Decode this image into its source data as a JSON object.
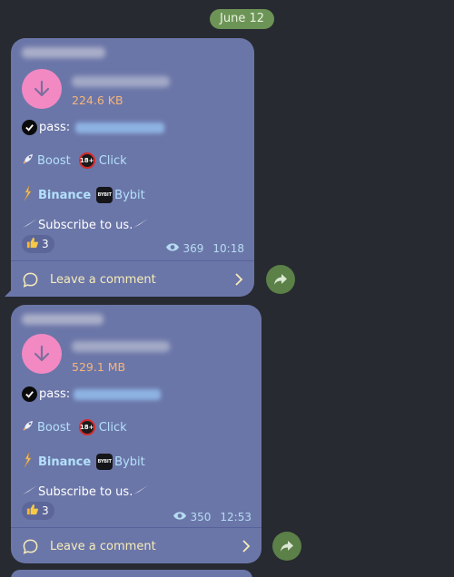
{
  "date_label": "June 12",
  "messages": [
    {
      "file_size": "224.6 KB",
      "pass_label": "pass:",
      "boost_label": "Boost",
      "badge_18": "18+",
      "click_label": "Click",
      "binance_label": "Binance",
      "bybit_icon_text": "BYBIT",
      "bybit_label": "Bybit",
      "subscribe_label": "Subscribe to us.",
      "reaction_count": "3",
      "views": "369",
      "time": "10:18",
      "comment_label": "Leave a comment"
    },
    {
      "file_size": "529.1 MB",
      "pass_label": "pass:",
      "boost_label": "Boost",
      "badge_18": "18+",
      "click_label": "Click",
      "binance_label": "Binance",
      "bybit_icon_text": "BYBIT",
      "bybit_label": "Bybit",
      "subscribe_label": "Subscribe to us.",
      "reaction_count": "3",
      "views": "350",
      "time": "12:53",
      "comment_label": "Leave a comment"
    }
  ],
  "colors": {
    "background": "#272a30",
    "bubble": "#6b76a8",
    "date_pill": "#6c9456",
    "download_circle": "#f289c3",
    "file_size": "#f5b57b",
    "link": "#b3e0fb",
    "comment": "#f6ecb9",
    "share_button": "#5b8048"
  },
  "icons": [
    "download-icon",
    "check-icon",
    "rocket-icon",
    "adult-badge-icon",
    "binance-icon",
    "bybit-icon",
    "paper-plane-icon",
    "thumbs-up-icon",
    "eye-icon",
    "comment-icon",
    "chevron-right-icon",
    "share-icon"
  ]
}
